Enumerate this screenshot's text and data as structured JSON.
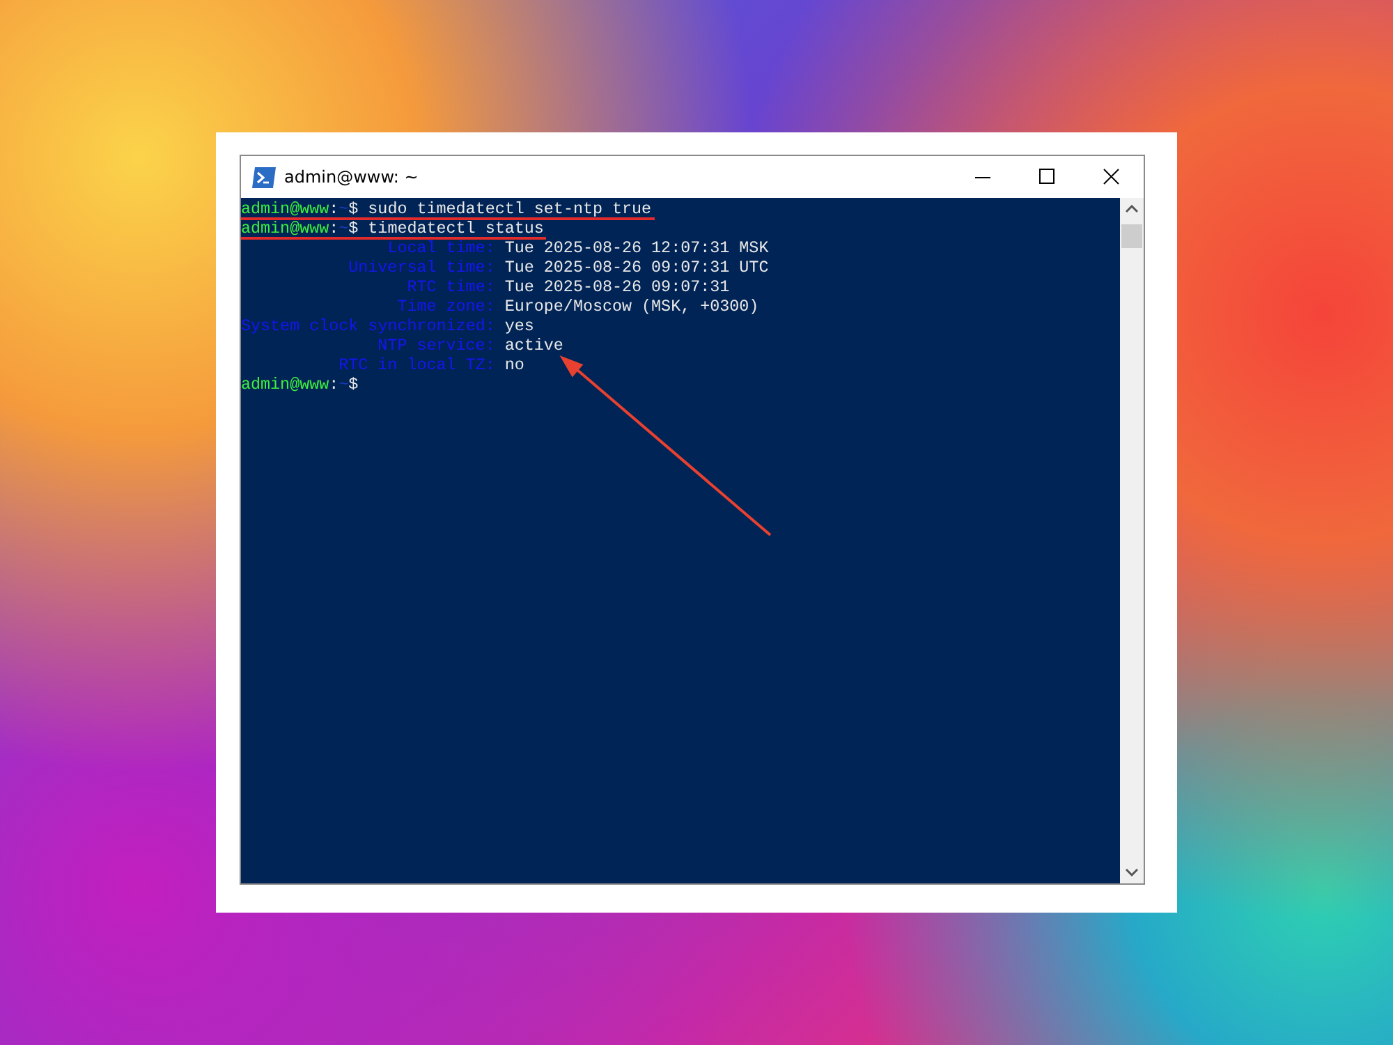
{
  "window": {
    "title": "admin@www: ~"
  },
  "terminal": {
    "lines": [
      {
        "kind": "prompt",
        "user": "admin@www",
        "sep": ":",
        "path": "~",
        "symbol": "$",
        "command": "sudo timedatectl set-ntp true",
        "underlined": true
      },
      {
        "kind": "prompt",
        "user": "admin@www",
        "sep": ":",
        "path": "~",
        "symbol": "$",
        "command": "timedatectl status",
        "underlined": true
      },
      {
        "kind": "field",
        "label": "Local time:",
        "value": "Tue 2025-08-26 12:07:31 MSK"
      },
      {
        "kind": "field",
        "label": "Universal time:",
        "value": "Tue 2025-08-26 09:07:31 UTC"
      },
      {
        "kind": "field",
        "label": "RTC time:",
        "value": "Tue 2025-08-26 09:07:31"
      },
      {
        "kind": "field",
        "label": "Time zone:",
        "value": "Europe/Moscow (MSK, +0300)"
      },
      {
        "kind": "field",
        "label": "System clock synchronized:",
        "value": "yes"
      },
      {
        "kind": "field",
        "label": "NTP service:",
        "value": "active"
      },
      {
        "kind": "field",
        "label": "RTC in local TZ:",
        "value": "no"
      },
      {
        "kind": "prompt",
        "user": "admin@www",
        "sep": ":",
        "path": "~",
        "symbol": "$",
        "underlined": false
      }
    ]
  },
  "annotation": {
    "kind": "arrow"
  }
}
